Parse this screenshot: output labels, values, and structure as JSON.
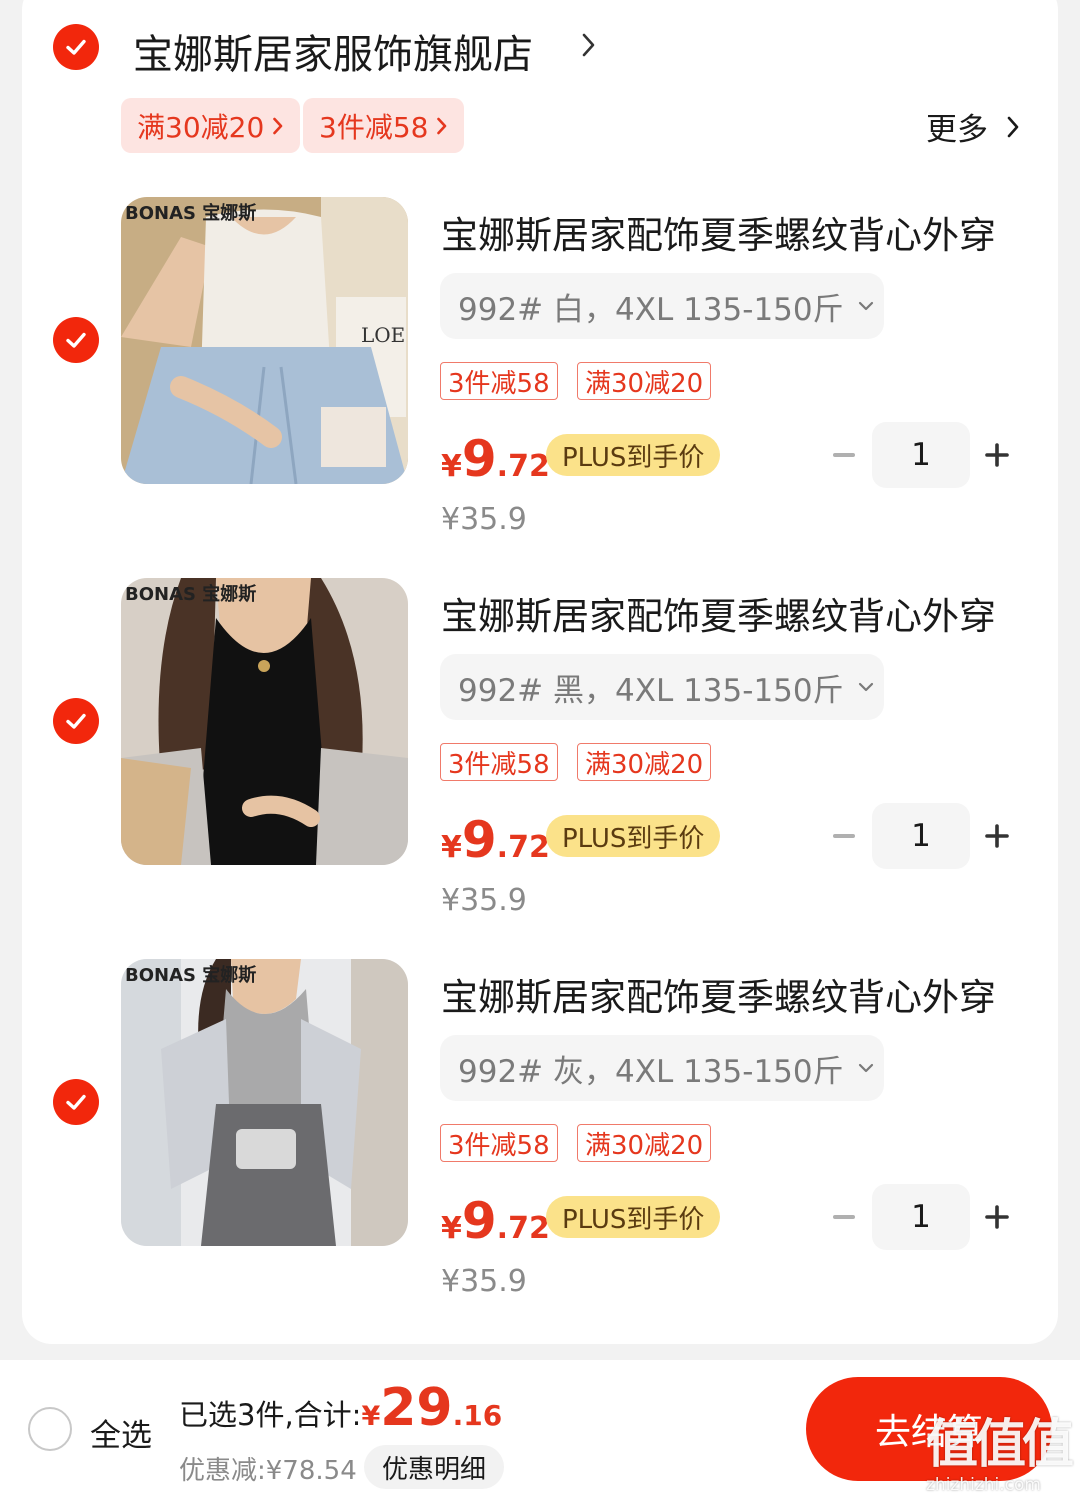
{
  "store": {
    "name": "宝娜斯居家服饰旗舰店",
    "selected": true
  },
  "promos": [
    {
      "label": "满30减20"
    },
    {
      "label": "3件减58"
    }
  ],
  "more_label": "更多",
  "items": [
    {
      "title": "宝娜斯居家配饰夏季螺纹背心外穿",
      "spec": "992# 白，4XL 135-150斤",
      "tags": [
        "3件减58",
        "满30减20"
      ],
      "price_yen": "¥",
      "price_int": "9",
      "price_dec": ".72",
      "plus_label": "PLUS到手价",
      "orig_price": "¥35.9",
      "qty": "1",
      "image_logo": "BONAS 宝娜斯",
      "image_prop_text": "LOE",
      "top_color": "#f1ede6",
      "selected": true
    },
    {
      "title": "宝娜斯居家配饰夏季螺纹背心外穿",
      "spec": "992# 黑，4XL 135-150斤",
      "tags": [
        "3件减58",
        "满30减20"
      ],
      "price_yen": "¥",
      "price_int": "9",
      "price_dec": ".72",
      "plus_label": "PLUS到手价",
      "orig_price": "¥35.9",
      "qty": "1",
      "image_logo": "BONAS 宝娜斯",
      "top_color": "#111111",
      "selected": true
    },
    {
      "title": "宝娜斯居家配饰夏季螺纹背心外穿",
      "spec": "992# 灰，4XL 135-150斤",
      "tags": [
        "3件减58",
        "满30减20"
      ],
      "price_yen": "¥",
      "price_int": "9",
      "price_dec": ".72",
      "plus_label": "PLUS到手价",
      "orig_price": "¥35.9",
      "qty": "1",
      "image_logo": "BONAS 宝娜斯",
      "top_color": "#a9a9aa",
      "selected": true
    }
  ],
  "footer": {
    "select_all_label": "全选",
    "summary_label": "已选3件,合计:",
    "total_yen": "¥",
    "total_int": "29",
    "total_dec": ".16",
    "discount_label": "优惠减:¥78.54",
    "detail_button": "优惠明细",
    "checkout_button": "去结算",
    "select_all_checked": false
  },
  "watermark": {
    "glyphs": "值值值",
    "url": "zhizhizhi.com"
  },
  "colors": {
    "accent": "#f2270c",
    "price": "#e5371e",
    "plus_badge": "#fbe28a",
    "tag_bg": "#fde4e1"
  },
  "icons": [
    "check-icon",
    "chevron-right-icon",
    "chevron-down-icon",
    "minus-icon",
    "plus-icon"
  ]
}
